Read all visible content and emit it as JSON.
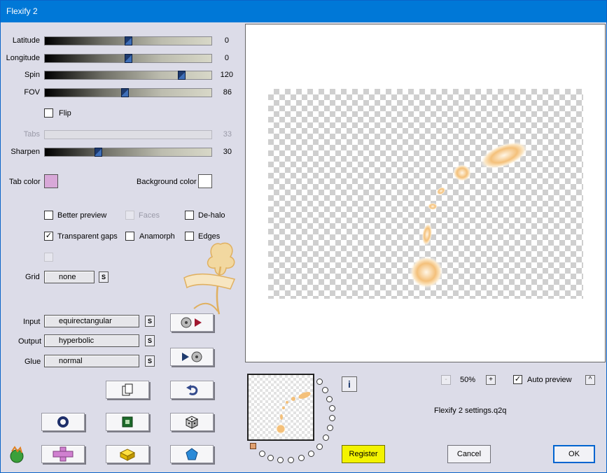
{
  "window": {
    "title": "Flexify 2"
  },
  "sliders": [
    {
      "id": "latitude",
      "label": "Latitude",
      "value": "0",
      "fraction": 0.5,
      "enabled": true
    },
    {
      "id": "longitude",
      "label": "Longitude",
      "value": "0",
      "fraction": 0.5,
      "enabled": true
    },
    {
      "id": "spin",
      "label": "Spin",
      "value": "120",
      "fraction": 0.82,
      "enabled": true
    },
    {
      "id": "fov",
      "label": "FOV",
      "value": "86",
      "fraction": 0.48,
      "enabled": true
    },
    {
      "id": "tabs",
      "label": "Tabs",
      "value": "33",
      "fraction": 0.33,
      "enabled": false
    },
    {
      "id": "sharpen",
      "label": "Sharpen",
      "value": "30",
      "fraction": 0.32,
      "enabled": true
    }
  ],
  "flip": {
    "label": "Flip",
    "checked": false
  },
  "colors": {
    "tab_label": "Tab color",
    "tab_value": "#d8a8d8",
    "bg_label": "Background color",
    "bg_value": "#ffffff"
  },
  "options": {
    "better_preview": {
      "label": "Better preview",
      "checked": false
    },
    "faces": {
      "label": "Faces",
      "checked": false
    },
    "dehalo": {
      "label": "De-halo",
      "checked": false
    },
    "transparent_gaps": {
      "label": "Transparent gaps",
      "checked": true
    },
    "anamorph": {
      "label": "Anamorph",
      "checked": false
    },
    "edges": {
      "label": "Edges",
      "checked": false
    }
  },
  "grid": {
    "label": "Grid",
    "value": "none"
  },
  "projection": {
    "input_label": "Input",
    "input_value": "equirectangular",
    "output_label": "Output",
    "output_value": "hyperbolic",
    "glue_label": "Glue",
    "glue_value": "normal"
  },
  "small_button_label": "S",
  "zoom": {
    "value": "50%",
    "minus": "-",
    "plus": "+"
  },
  "auto_preview": {
    "label": "Auto preview",
    "checked": true,
    "caret": "^"
  },
  "settings_file": "Flexify 2 settings.q2q",
  "info_label": "i",
  "buttons": {
    "register": "Register",
    "cancel": "Cancel",
    "ok": "OK"
  },
  "icons": {
    "check": "✓"
  }
}
